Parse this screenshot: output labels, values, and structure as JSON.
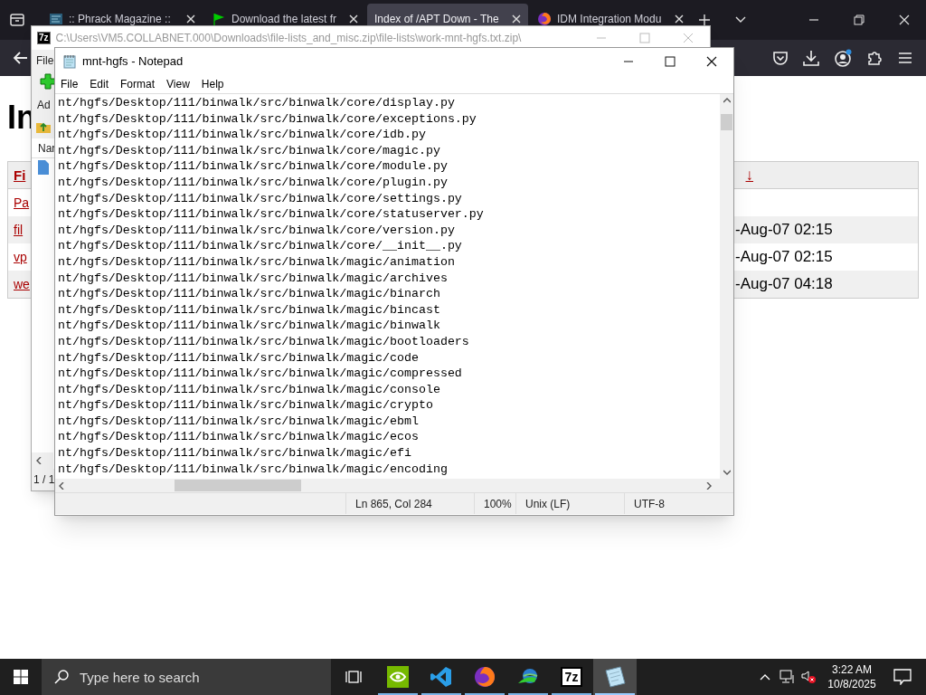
{
  "browser": {
    "tabs": [
      {
        "title": ":: Phrack Magazine ::",
        "selected": false
      },
      {
        "title": "Download the latest fr",
        "selected": false
      },
      {
        "title": "Index of /APT Down - The",
        "selected": true
      },
      {
        "title": "IDM Integration Modu",
        "selected": false
      }
    ],
    "page": {
      "heading": "In",
      "table": {
        "columns": [
          "Fi",
          "↓"
        ],
        "rows": [
          {
            "name": "Pa"
          },
          {
            "name": "fil",
            "modified": "-Aug-07 02:15"
          },
          {
            "name": "vp",
            "modified": "-Aug-07 02:15"
          },
          {
            "name": "we",
            "modified": "-Aug-07 04:18"
          }
        ]
      }
    }
  },
  "archive_window": {
    "logo": "7z",
    "title": "C:\\Users\\VM5.COLLABNET.000\\Downloads\\file-lists_and_misc.zip\\file-lists\\work-mnt-hgfs.txt.zip\\",
    "menu": [
      "File"
    ],
    "toolbar": [
      "Ad"
    ],
    "column": "Nar",
    "status": "1 / 1"
  },
  "notepad": {
    "title": "mnt-hgfs - Notepad",
    "menu": [
      "File",
      "Edit",
      "Format",
      "View",
      "Help"
    ],
    "lines": [
      "nt/hgfs/Desktop/111/binwalk/src/binwalk/core/display.py",
      "nt/hgfs/Desktop/111/binwalk/src/binwalk/core/exceptions.py",
      "nt/hgfs/Desktop/111/binwalk/src/binwalk/core/idb.py",
      "nt/hgfs/Desktop/111/binwalk/src/binwalk/core/magic.py",
      "nt/hgfs/Desktop/111/binwalk/src/binwalk/core/module.py",
      "nt/hgfs/Desktop/111/binwalk/src/binwalk/core/plugin.py",
      "nt/hgfs/Desktop/111/binwalk/src/binwalk/core/settings.py",
      "nt/hgfs/Desktop/111/binwalk/src/binwalk/core/statuserver.py",
      "nt/hgfs/Desktop/111/binwalk/src/binwalk/core/version.py",
      "nt/hgfs/Desktop/111/binwalk/src/binwalk/core/__init__.py",
      "nt/hgfs/Desktop/111/binwalk/src/binwalk/magic/animation",
      "nt/hgfs/Desktop/111/binwalk/src/binwalk/magic/archives",
      "nt/hgfs/Desktop/111/binwalk/src/binwalk/magic/binarch",
      "nt/hgfs/Desktop/111/binwalk/src/binwalk/magic/bincast",
      "nt/hgfs/Desktop/111/binwalk/src/binwalk/magic/binwalk",
      "nt/hgfs/Desktop/111/binwalk/src/binwalk/magic/bootloaders",
      "nt/hgfs/Desktop/111/binwalk/src/binwalk/magic/code",
      "nt/hgfs/Desktop/111/binwalk/src/binwalk/magic/compressed",
      "nt/hgfs/Desktop/111/binwalk/src/binwalk/magic/console",
      "nt/hgfs/Desktop/111/binwalk/src/binwalk/magic/crypto",
      "nt/hgfs/Desktop/111/binwalk/src/binwalk/magic/ebml",
      "nt/hgfs/Desktop/111/binwalk/src/binwalk/magic/ecos",
      "nt/hgfs/Desktop/111/binwalk/src/binwalk/magic/efi",
      "nt/hgfs/Desktop/111/binwalk/src/binwalk/magic/encoding"
    ],
    "status": [
      "Ln 865, Col 284",
      "100%",
      "Unix (LF)",
      "UTF-8"
    ]
  },
  "taskbar": {
    "search_placeholder": "Type here to search",
    "apps": [
      {
        "selected": false
      },
      {
        "selected": false
      },
      {
        "selected": false
      },
      {
        "selected": false
      },
      {
        "label": "7z",
        "selected": false
      },
      {
        "selected": true
      }
    ],
    "time": "3:22 AM",
    "date": "10/8/2025"
  }
}
